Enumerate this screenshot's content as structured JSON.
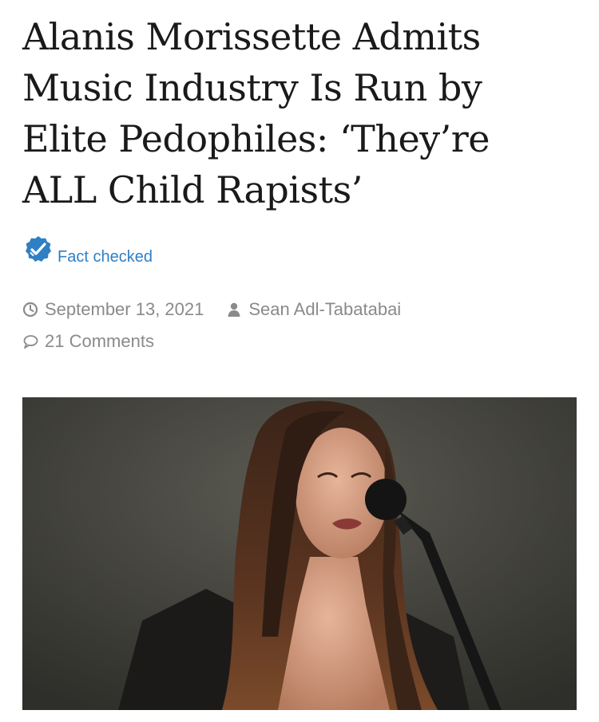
{
  "article": {
    "headline_lines": [
      "Alanis Morissette Admits",
      "Music Industry Is Run by",
      "Elite Pedophiles: ‘They’re",
      "ALL Child Rapists’"
    ],
    "fact_check": {
      "label": "Fact checked",
      "icon": "checkmark-badge-icon",
      "color": "#2f7fc4"
    },
    "meta": {
      "date": "September 13, 2021",
      "date_icon": "clock-icon",
      "author": "Sean Adl-Tabatabai",
      "author_icon": "user-icon",
      "comments": "21 Comments",
      "comments_icon": "comment-icon"
    },
    "featured_image": {
      "kind": "photo of a woman with long dark hair singing into a microphone"
    }
  }
}
